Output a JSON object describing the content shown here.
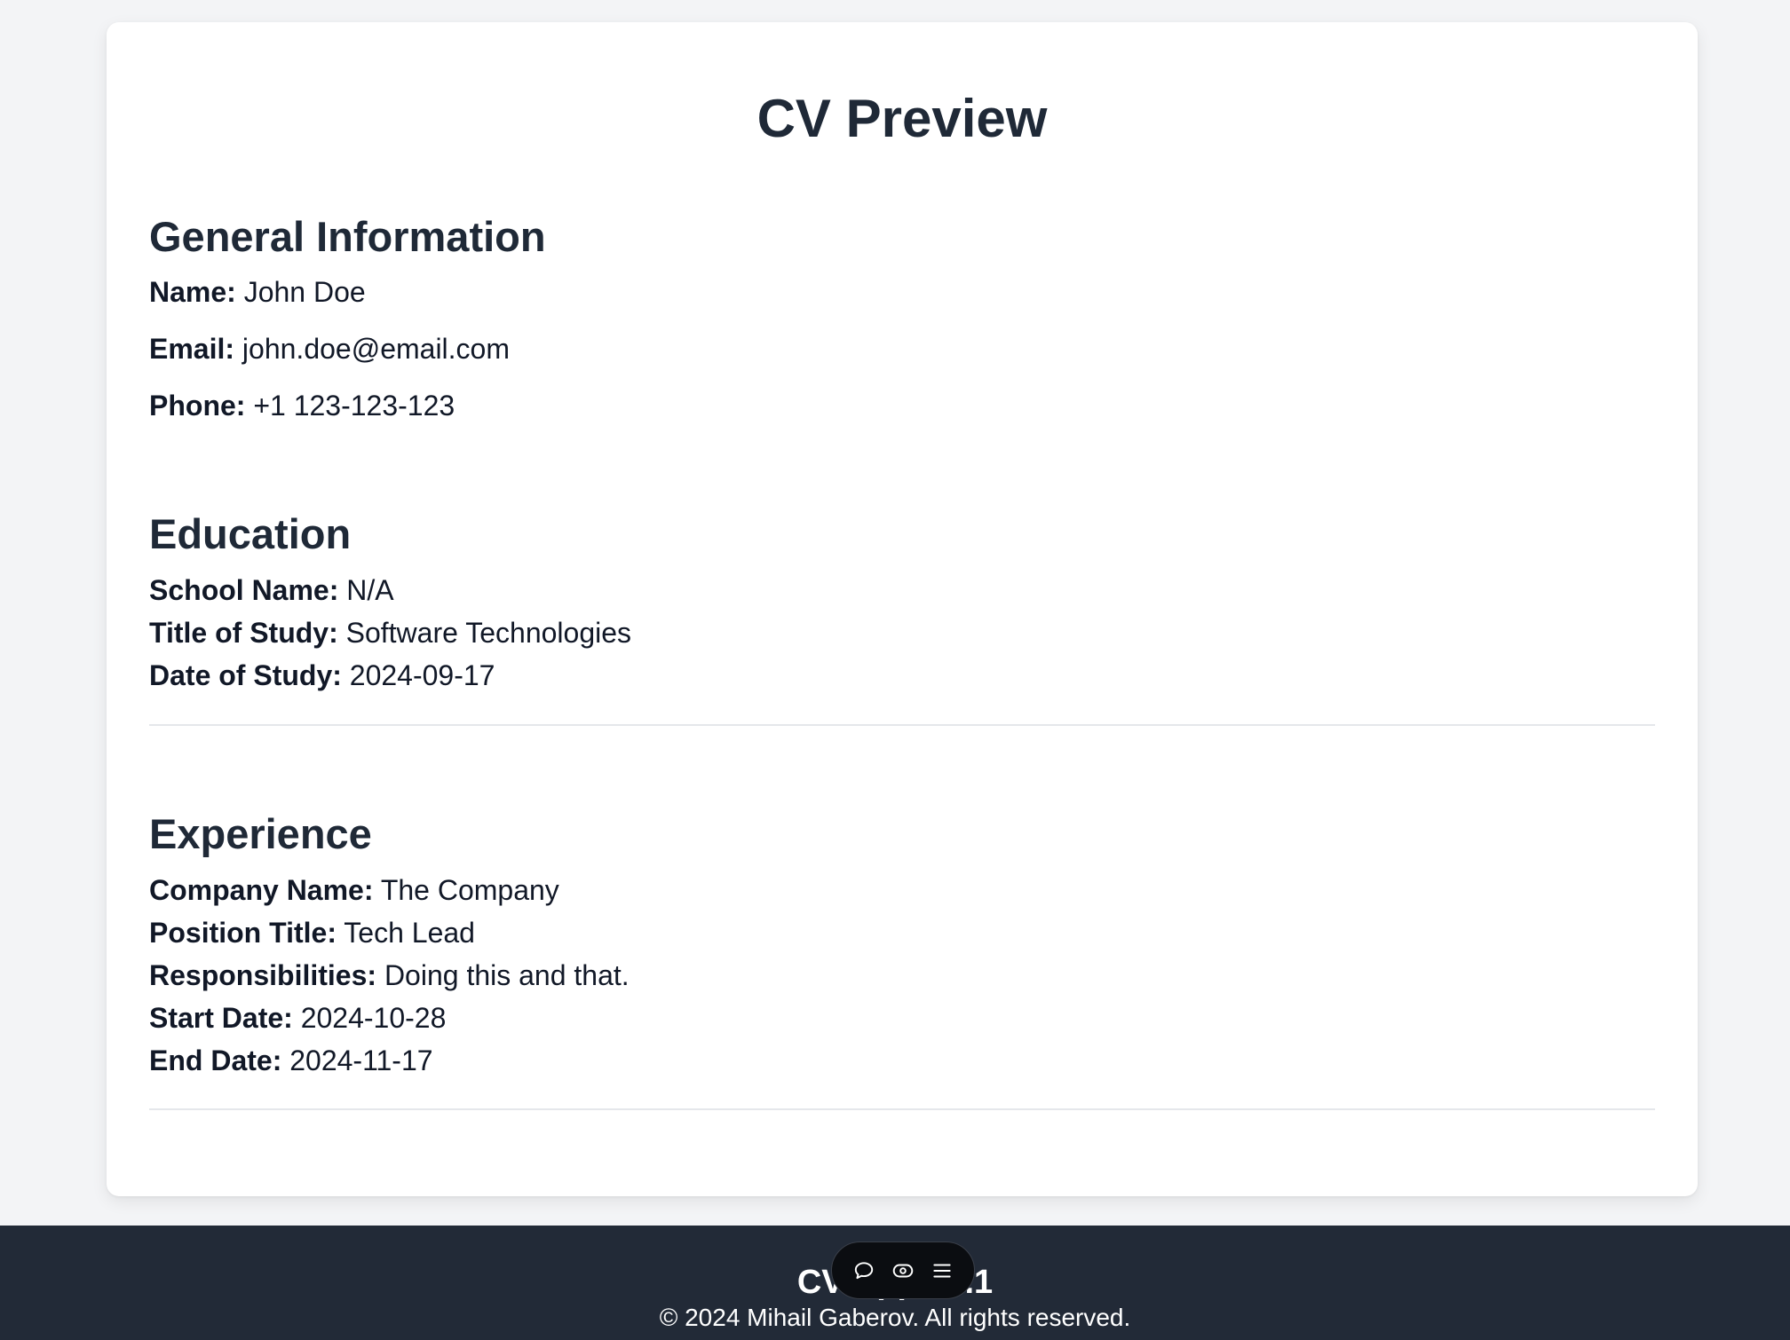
{
  "page": {
    "title": "CV Preview"
  },
  "general": {
    "heading": "General Information",
    "name_label": "Name:",
    "name_value": "John Doe",
    "email_label": "Email:",
    "email_value": "john.doe@email.com",
    "phone_label": "Phone:",
    "phone_value": "+1 123-123-123"
  },
  "education": {
    "heading": "Education",
    "school_label": "School Name:",
    "school_value": "N/A",
    "title_label": "Title of Study:",
    "title_value": "Software Technologies",
    "date_label": "Date of Study:",
    "date_value": "2024-09-17"
  },
  "experience": {
    "heading": "Experience",
    "company_label": "Company Name:",
    "company_value": "The Company",
    "position_label": "Position Title:",
    "position_value": "Tech Lead",
    "resp_label": "Responsibilities:",
    "resp_value": "Doing this and that.",
    "start_label": "Start Date:",
    "start_value": "2024-10-28",
    "end_label": "End Date:",
    "end_value": "2024-11-17"
  },
  "footer": {
    "title": "CV App v1.1",
    "copyright": "© 2024 Mihail Gaberov. All rights reserved."
  },
  "toolbar": {
    "icons": [
      "comment-icon",
      "eye-icon",
      "menu-icon"
    ]
  }
}
